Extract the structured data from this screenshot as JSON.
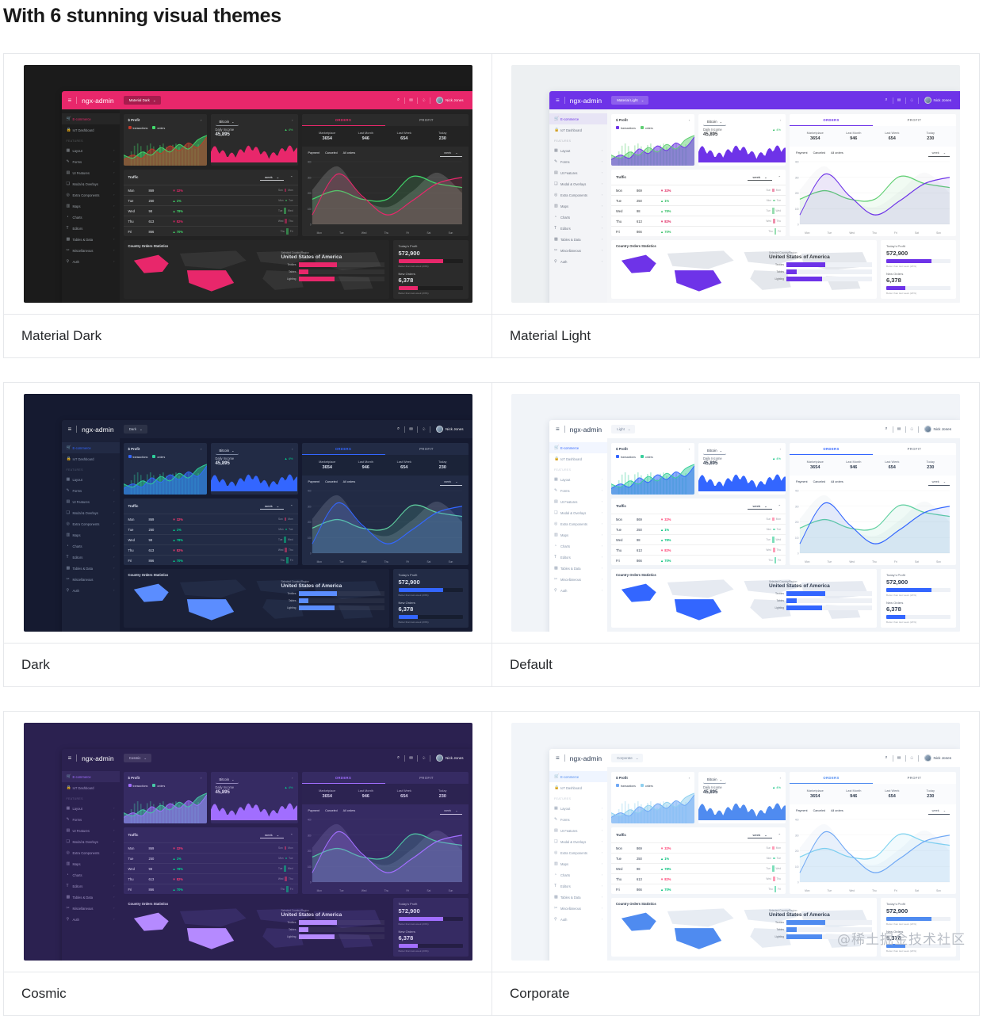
{
  "page": {
    "title": "With 6 stunning visual themes",
    "watermark": "@稀土掘金技术社区"
  },
  "app": {
    "brand": "ngx-admin",
    "burger_icon": "hamburger-menu-icon",
    "user_name": "Nick Jones",
    "header_icons": [
      "search-icon",
      "email-icon",
      "bell-icon"
    ],
    "sidebar": {
      "top": [
        {
          "label": "E-commerce",
          "icon": "cart-icon",
          "active": true
        },
        {
          "label": "IoT Dashboard",
          "icon": "lock-icon",
          "active": false
        }
      ],
      "group_label": "FEATURES",
      "items": [
        {
          "label": "Layout",
          "icon": "layout-icon"
        },
        {
          "label": "Forms",
          "icon": "forms-icon"
        },
        {
          "label": "UI Features",
          "icon": "grid-icon"
        },
        {
          "label": "Modal & Overlays",
          "icon": "modal-icon"
        },
        {
          "label": "Extra Components",
          "icon": "components-icon"
        },
        {
          "label": "Maps",
          "icon": "map-icon"
        },
        {
          "label": "Charts",
          "icon": "chart-icon"
        },
        {
          "label": "Editors",
          "icon": "text-icon"
        },
        {
          "label": "Tables & Data",
          "icon": "table-icon"
        },
        {
          "label": "Miscellaneous",
          "icon": "misc-icon"
        },
        {
          "label": "Auth",
          "icon": "auth-icon"
        }
      ]
    },
    "profit_card": {
      "title": "$ Profit",
      "caret": "›",
      "legend": [
        {
          "label": "transactions"
        },
        {
          "label": "orders"
        }
      ]
    },
    "bitcoin_card": {
      "selector": "Bitcoin",
      "caret": "›",
      "income_label": "Daily Income",
      "income_value": "45,895",
      "delta": "4%"
    },
    "traffic": {
      "title": "Traffic",
      "period": "week",
      "collapse_icon": "chevron-up-icon",
      "rows": [
        {
          "day": "Mon",
          "value": "869",
          "delta": "32%",
          "dir": "down",
          "from": "Sun",
          "to": "Mon",
          "bar": 38
        },
        {
          "day": "Tue",
          "value": "250",
          "delta": "1%",
          "dir": "up",
          "from": "Mon",
          "to": "Tue",
          "bar": 14
        },
        {
          "day": "Wed",
          "value": "98",
          "delta": "78%",
          "dir": "up",
          "from": "Tue",
          "to": "Wed",
          "bar": 72
        },
        {
          "day": "Thu",
          "value": "613",
          "delta": "82%",
          "dir": "down",
          "from": "Wed",
          "to": "Thu",
          "bar": 55
        },
        {
          "day": "Fri",
          "value": "866",
          "delta": "70%",
          "dir": "up",
          "from": "Thu",
          "to": "Fri",
          "bar": 66
        }
      ]
    },
    "orders": {
      "tabs": [
        {
          "label": "ORDERS",
          "active": true
        },
        {
          "label": "PROFIT",
          "active": false
        }
      ],
      "kpis": [
        {
          "label": "Marketplace",
          "value": "3654"
        },
        {
          "label": "Last Month",
          "value": "946"
        },
        {
          "label": "Last Week",
          "value": "654"
        },
        {
          "label": "Today",
          "value": "230"
        }
      ],
      "legend": [
        {
          "label": "Payment"
        },
        {
          "label": "Canceled"
        },
        {
          "label": "All orders"
        }
      ],
      "period": "week"
    },
    "country": {
      "title": "Country Orders Statistics",
      "selected_label": "Selected Country/Region",
      "country": "United States of America",
      "bars": [
        {
          "label": "Textiles",
          "value": 45
        },
        {
          "label": "Tables",
          "value": 12
        },
        {
          "label": "Lighting",
          "value": 42
        }
      ]
    },
    "profit_today": {
      "label": "Today's Profit",
      "value": "572,900",
      "note": "Better than last week (23%)",
      "fill": 70
    },
    "new_orders": {
      "label": "New Orders",
      "value": "6,378",
      "note": "Better than last week (23%)",
      "fill": 30
    }
  },
  "chart_data": {
    "type": "line",
    "title": "Orders",
    "x": [
      "Mon",
      "Tue",
      "Wed",
      "Thu",
      "Fri",
      "Sat",
      "Sun"
    ],
    "ylim": [
      0,
      400
    ],
    "yticks": [
      0,
      100,
      200,
      300,
      400
    ],
    "series": [
      {
        "name": "Payment",
        "values": [
          60,
          320,
          180,
          60,
          150,
          260,
          300
        ]
      },
      {
        "name": "Canceled",
        "values": [
          160,
          215,
          160,
          160,
          305,
          260,
          235
        ]
      },
      {
        "name": "All orders",
        "values": [
          220,
          370,
          170,
          110,
          210,
          330,
          200
        ]
      }
    ],
    "legend_position": "top-left",
    "grid": true
  },
  "themes": [
    {
      "key": "mdark",
      "label": "Material Dark",
      "selector": "Material Dark",
      "accent": "#e8276b"
    },
    {
      "key": "mlight",
      "label": "Material Light",
      "selector": "Material Light",
      "accent": "#6e33e8"
    },
    {
      "key": "dark",
      "label": "Dark",
      "selector": "Dark",
      "accent": "#3366ff"
    },
    {
      "key": "default",
      "label": "Default",
      "selector": "Light",
      "accent": "#3366ff"
    },
    {
      "key": "cosmic",
      "label": "Cosmic",
      "selector": "Cosmic",
      "accent": "#a16eff"
    },
    {
      "key": "corp",
      "label": "Corporate",
      "selector": "Corporate",
      "accent": "#4f8bf0"
    }
  ]
}
